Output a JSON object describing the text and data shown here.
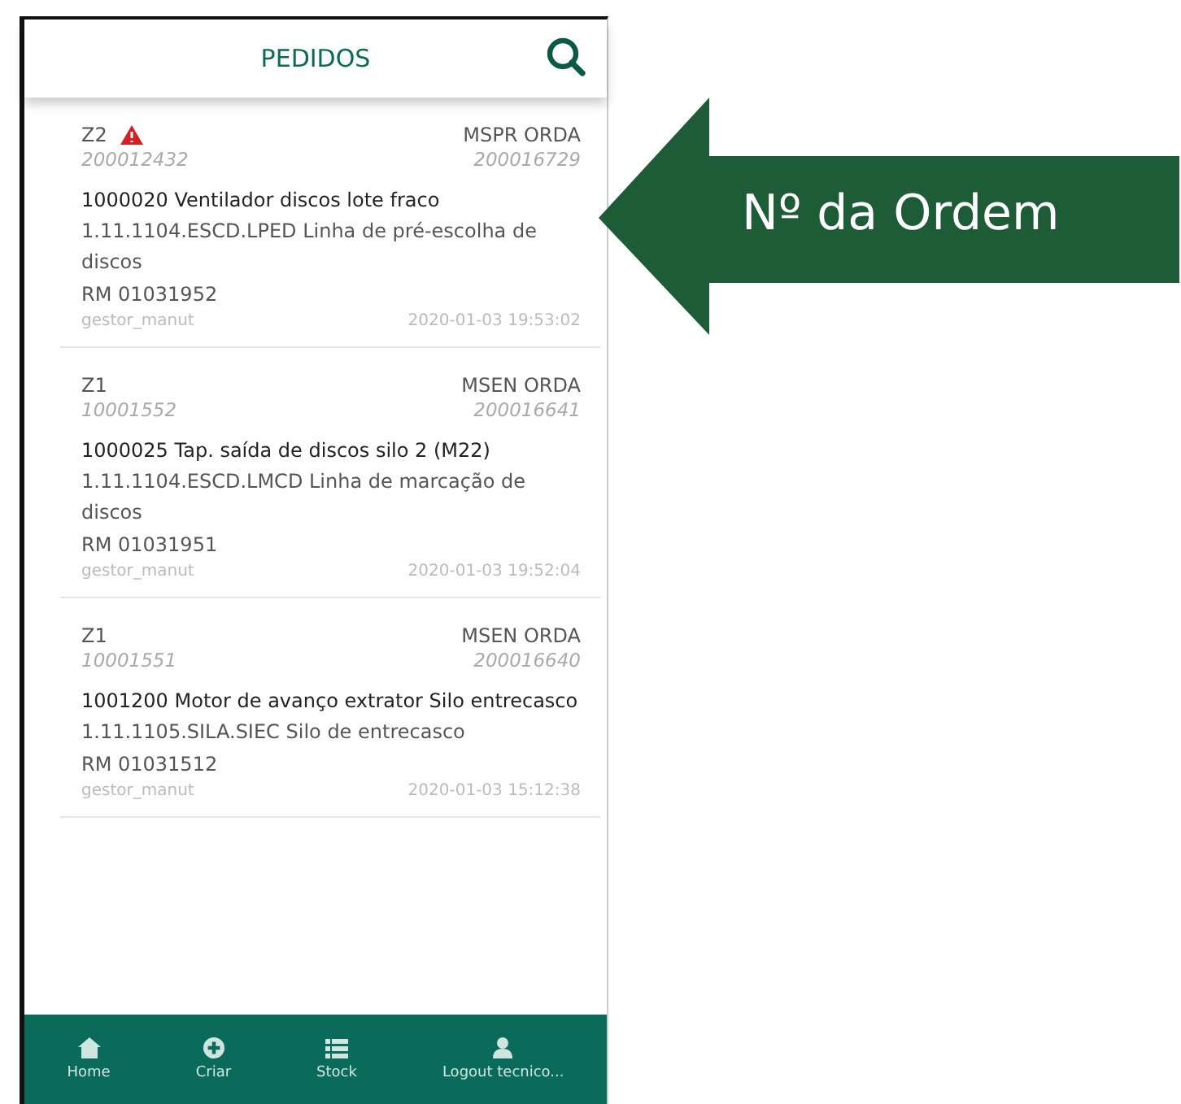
{
  "header": {
    "title": "PEDIDOS"
  },
  "orders": [
    {
      "priority": "Z2",
      "alert": true,
      "type": "MSPR ORDA",
      "notification": "200012432",
      "order": "200016729",
      "equipment": "1000020 Ventilador discos lote fraco",
      "location": "1.11.1104.ESCD.LPED Linha de pré-escolha de discos",
      "rm": "RM 01031952",
      "user": "gestor_manut",
      "datetime": "2020-01-03 19:53:02"
    },
    {
      "priority": "Z1",
      "alert": false,
      "type": "MSEN ORDA",
      "notification": "10001552",
      "order": "200016641",
      "equipment": "1000025 Tap. saída de discos silo 2 (M22)",
      "location": "1.11.1104.ESCD.LMCD Linha de marcação de discos",
      "rm": "RM 01031951",
      "user": "gestor_manut",
      "datetime": "2020-01-03 19:52:04"
    },
    {
      "priority": "Z1",
      "alert": false,
      "type": "MSEN ORDA",
      "notification": "10001551",
      "order": "200016640",
      "equipment": "1001200 Motor de avanço extrator Silo entrecasco",
      "location": "1.11.1105.SILA.SIEC Silo de entrecasco",
      "rm": "RM 01031512",
      "user": "gestor_manut",
      "datetime": "2020-01-03 15:12:38"
    }
  ],
  "nav": [
    {
      "kind": "home",
      "label": "Home"
    },
    {
      "kind": "create",
      "label": "Criar"
    },
    {
      "kind": "list",
      "label": "Stock"
    },
    {
      "kind": "user",
      "label": "Logout tecnico..."
    }
  ],
  "callout": {
    "label": "Nº da Ordem"
  }
}
